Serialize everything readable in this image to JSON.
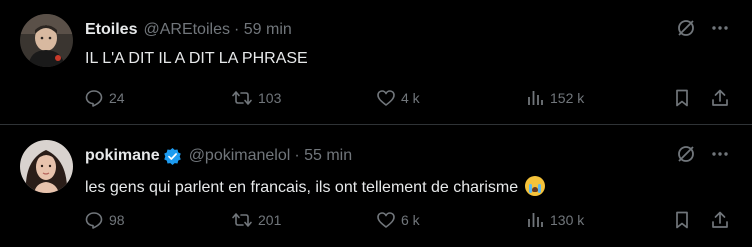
{
  "tweets": [
    {
      "name": "Etoiles",
      "handle": "@AREtoiles",
      "time": "· 59 min",
      "text": "IL L'A DIT IL A DIT LA PHRASE",
      "verified": false,
      "replies": "24",
      "retweets": "103",
      "likes": "4 k",
      "views": "152 k"
    },
    {
      "name": "pokimane",
      "handle": "@pokimanelol",
      "time": "· 55 min",
      "text": "les gens qui parlent en francais, ils ont tellement de charisme",
      "emoji": "loudly-crying-face",
      "verified": true,
      "replies": "98",
      "retweets": "201",
      "likes": "6 k",
      "views": "130 k"
    }
  ],
  "colors": {
    "background": "#000000",
    "text": "#e7e9ea",
    "muted": "#71767b",
    "divider": "#2f3336",
    "verified": "#1d9bf0"
  }
}
